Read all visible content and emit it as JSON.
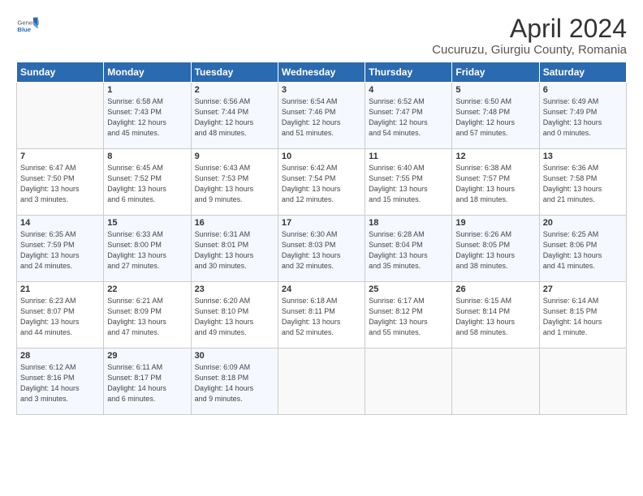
{
  "logo": {
    "general": "General",
    "blue": "Blue"
  },
  "title": "April 2024",
  "subtitle": "Cucuruzu, Giurgiu County, Romania",
  "headers": [
    "Sunday",
    "Monday",
    "Tuesday",
    "Wednesday",
    "Thursday",
    "Friday",
    "Saturday"
  ],
  "weeks": [
    [
      {
        "day": "",
        "info": ""
      },
      {
        "day": "1",
        "info": "Sunrise: 6:58 AM\nSunset: 7:43 PM\nDaylight: 12 hours\nand 45 minutes."
      },
      {
        "day": "2",
        "info": "Sunrise: 6:56 AM\nSunset: 7:44 PM\nDaylight: 12 hours\nand 48 minutes."
      },
      {
        "day": "3",
        "info": "Sunrise: 6:54 AM\nSunset: 7:46 PM\nDaylight: 12 hours\nand 51 minutes."
      },
      {
        "day": "4",
        "info": "Sunrise: 6:52 AM\nSunset: 7:47 PM\nDaylight: 12 hours\nand 54 minutes."
      },
      {
        "day": "5",
        "info": "Sunrise: 6:50 AM\nSunset: 7:48 PM\nDaylight: 12 hours\nand 57 minutes."
      },
      {
        "day": "6",
        "info": "Sunrise: 6:49 AM\nSunset: 7:49 PM\nDaylight: 13 hours\nand 0 minutes."
      }
    ],
    [
      {
        "day": "7",
        "info": "Sunrise: 6:47 AM\nSunset: 7:50 PM\nDaylight: 13 hours\nand 3 minutes."
      },
      {
        "day": "8",
        "info": "Sunrise: 6:45 AM\nSunset: 7:52 PM\nDaylight: 13 hours\nand 6 minutes."
      },
      {
        "day": "9",
        "info": "Sunrise: 6:43 AM\nSunset: 7:53 PM\nDaylight: 13 hours\nand 9 minutes."
      },
      {
        "day": "10",
        "info": "Sunrise: 6:42 AM\nSunset: 7:54 PM\nDaylight: 13 hours\nand 12 minutes."
      },
      {
        "day": "11",
        "info": "Sunrise: 6:40 AM\nSunset: 7:55 PM\nDaylight: 13 hours\nand 15 minutes."
      },
      {
        "day": "12",
        "info": "Sunrise: 6:38 AM\nSunset: 7:57 PM\nDaylight: 13 hours\nand 18 minutes."
      },
      {
        "day": "13",
        "info": "Sunrise: 6:36 AM\nSunset: 7:58 PM\nDaylight: 13 hours\nand 21 minutes."
      }
    ],
    [
      {
        "day": "14",
        "info": "Sunrise: 6:35 AM\nSunset: 7:59 PM\nDaylight: 13 hours\nand 24 minutes."
      },
      {
        "day": "15",
        "info": "Sunrise: 6:33 AM\nSunset: 8:00 PM\nDaylight: 13 hours\nand 27 minutes."
      },
      {
        "day": "16",
        "info": "Sunrise: 6:31 AM\nSunset: 8:01 PM\nDaylight: 13 hours\nand 30 minutes."
      },
      {
        "day": "17",
        "info": "Sunrise: 6:30 AM\nSunset: 8:03 PM\nDaylight: 13 hours\nand 32 minutes."
      },
      {
        "day": "18",
        "info": "Sunrise: 6:28 AM\nSunset: 8:04 PM\nDaylight: 13 hours\nand 35 minutes."
      },
      {
        "day": "19",
        "info": "Sunrise: 6:26 AM\nSunset: 8:05 PM\nDaylight: 13 hours\nand 38 minutes."
      },
      {
        "day": "20",
        "info": "Sunrise: 6:25 AM\nSunset: 8:06 PM\nDaylight: 13 hours\nand 41 minutes."
      }
    ],
    [
      {
        "day": "21",
        "info": "Sunrise: 6:23 AM\nSunset: 8:07 PM\nDaylight: 13 hours\nand 44 minutes."
      },
      {
        "day": "22",
        "info": "Sunrise: 6:21 AM\nSunset: 8:09 PM\nDaylight: 13 hours\nand 47 minutes."
      },
      {
        "day": "23",
        "info": "Sunrise: 6:20 AM\nSunset: 8:10 PM\nDaylight: 13 hours\nand 49 minutes."
      },
      {
        "day": "24",
        "info": "Sunrise: 6:18 AM\nSunset: 8:11 PM\nDaylight: 13 hours\nand 52 minutes."
      },
      {
        "day": "25",
        "info": "Sunrise: 6:17 AM\nSunset: 8:12 PM\nDaylight: 13 hours\nand 55 minutes."
      },
      {
        "day": "26",
        "info": "Sunrise: 6:15 AM\nSunset: 8:14 PM\nDaylight: 13 hours\nand 58 minutes."
      },
      {
        "day": "27",
        "info": "Sunrise: 6:14 AM\nSunset: 8:15 PM\nDaylight: 14 hours\nand 1 minute."
      }
    ],
    [
      {
        "day": "28",
        "info": "Sunrise: 6:12 AM\nSunset: 8:16 PM\nDaylight: 14 hours\nand 3 minutes."
      },
      {
        "day": "29",
        "info": "Sunrise: 6:11 AM\nSunset: 8:17 PM\nDaylight: 14 hours\nand 6 minutes."
      },
      {
        "day": "30",
        "info": "Sunrise: 6:09 AM\nSunset: 8:18 PM\nDaylight: 14 hours\nand 9 minutes."
      },
      {
        "day": "",
        "info": ""
      },
      {
        "day": "",
        "info": ""
      },
      {
        "day": "",
        "info": ""
      },
      {
        "day": "",
        "info": ""
      }
    ]
  ]
}
